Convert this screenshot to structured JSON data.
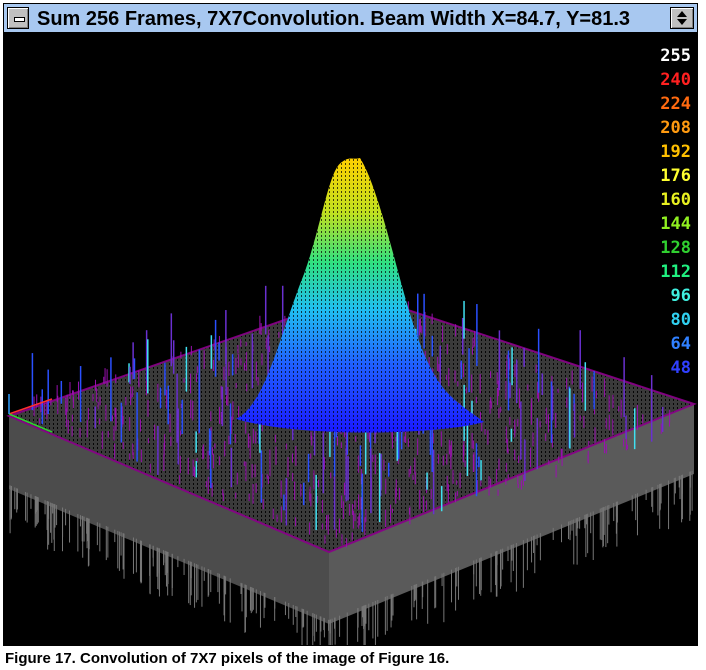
{
  "window": {
    "title": "Sum 256 Frames, 7X7Convolution. Beam Width X=84.7, Y=81.3",
    "system_menu_icon": "minus-icon",
    "resize_icon": "up-down-arrows-icon"
  },
  "colors": {
    "title_bar": "#a8c8f0",
    "background": "#000000",
    "base_platform": "#555555",
    "plate_grid": "#800080"
  },
  "scale": {
    "labels": [
      {
        "text": "255",
        "color": "#ffffff"
      },
      {
        "text": "240",
        "color": "#ff2020"
      },
      {
        "text": "224",
        "color": "#ff6a10"
      },
      {
        "text": "208",
        "color": "#ff9a10"
      },
      {
        "text": "192",
        "color": "#ffc000"
      },
      {
        "text": "176",
        "color": "#ffff30"
      },
      {
        "text": "160",
        "color": "#e8f020"
      },
      {
        "text": "144",
        "color": "#90f020"
      },
      {
        "text": "128",
        "color": "#30d030"
      },
      {
        "text": "112",
        "color": "#20f080"
      },
      {
        "text": "96",
        "color": "#40f0e0"
      },
      {
        "text": "80",
        "color": "#30d0f0"
      },
      {
        "text": "64",
        "color": "#3080ff"
      },
      {
        "text": "48",
        "color": "#3040ff"
      }
    ]
  },
  "caption": "Figure 17. Convolution of 7X7 pixels of the image of Figure 16."
}
